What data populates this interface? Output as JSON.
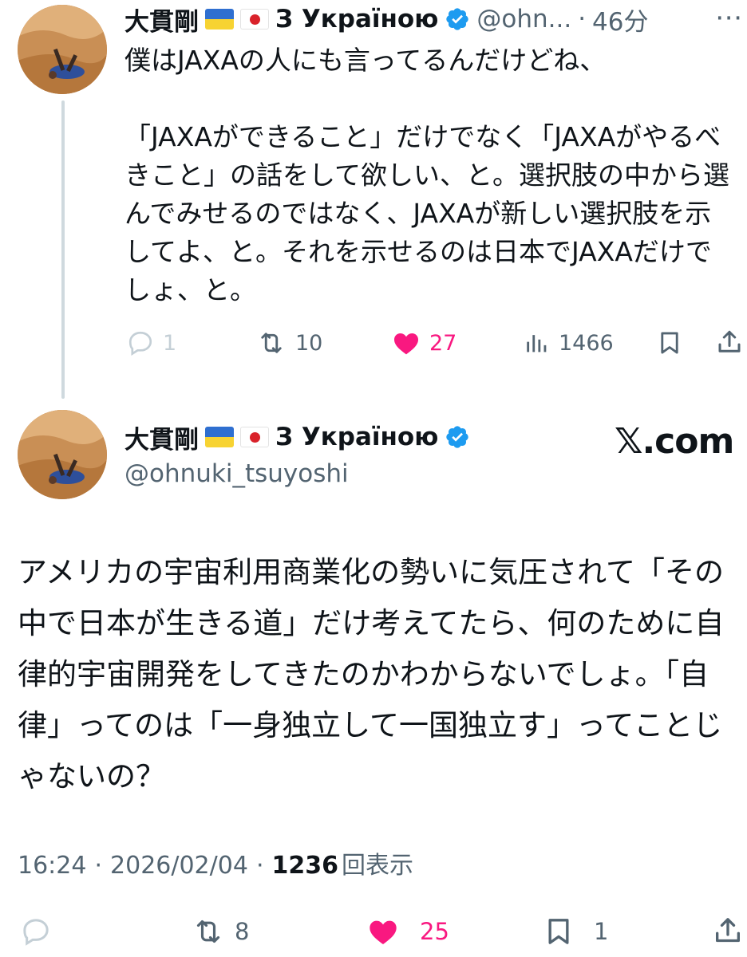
{
  "reply_tweet": {
    "author_name": "大貫剛",
    "author_suffix": "З Україною",
    "handle": "@ohn...",
    "separator": "·",
    "time_ago": "46分",
    "text": "僕はJAXAの人にも言ってるんだけどね、\n\n「JAXAができること」だけでなく「JAXAがやるべきこと」の話をして欲しい、と。選択肢の中から選んでみせるのではなく、JAXAが新しい選択肢を示してよ、と。それを示せるのは日本でJAXAだけでしょ、と。",
    "replies": "1",
    "retweets": "10",
    "likes": "27",
    "views": "1466"
  },
  "main_tweet": {
    "author_name": "大貫剛",
    "author_suffix": "З Україною",
    "handle": "@ohnuki_tsuyoshi",
    "brand": "𝕏.com",
    "text": "アメリカの宇宙利用商業化の勢いに気圧されて「その中で日本が生きる道」だけ考えてたら、何のために自律的宇宙開発をしてきたのかわからないでしょ。「自律」ってのは「一身独立して一国独立す」ってことじゃないの？",
    "time": "16:24",
    "date": "2026/02/04",
    "separator": "·",
    "view_count": "1236",
    "view_label": "回表示",
    "retweets": "8",
    "likes": "25",
    "bookmarks": "1"
  },
  "icons": [
    "reply-icon",
    "retweet-icon",
    "heart-icon",
    "views-icon",
    "bookmark-icon",
    "share-icon",
    "more-icon",
    "verified-icon",
    "ukraine-flag-icon",
    "japan-flag-icon"
  ],
  "colors": {
    "like": "#f91880",
    "muted": "#536471",
    "verified": "#1d9bf0",
    "text": "#0f1419"
  }
}
